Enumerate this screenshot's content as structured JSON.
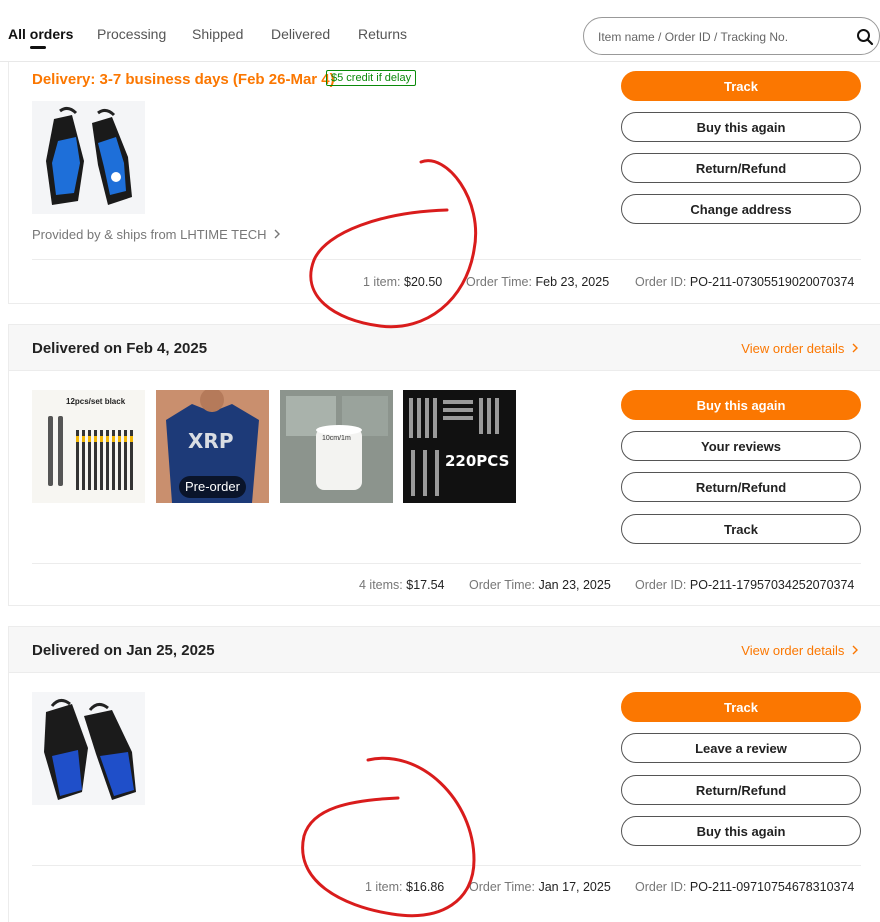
{
  "tabs": {
    "items": [
      {
        "label": "All orders"
      },
      {
        "label": "Processing"
      },
      {
        "label": "Shipped"
      },
      {
        "label": "Delivered"
      },
      {
        "label": "Returns"
      }
    ],
    "active": "All orders"
  },
  "search": {
    "placeholder": "Item name / Order ID / Tracking No.",
    "icon": "search-icon"
  },
  "orders": [
    {
      "delivery": "Delivery: 3-7 business days (Feb 26-Mar 4)",
      "credit_badge": "$5 credit if delay",
      "provided_by": "Provided by & ships from LHTIME TECH",
      "items_label": "1 item:",
      "items_total": "$20.50",
      "order_time_label": "Order Time:",
      "order_time": "Feb 23, 2025",
      "order_id_label": "Order ID:",
      "order_id": "PO-211-07305519020070374",
      "buttons": [
        "Track",
        "Buy this again",
        "Return/Refund",
        "Change address"
      ]
    },
    {
      "status": "Delivered on Feb 4, 2025",
      "view_details": "View order details",
      "items_label": "4 items:",
      "items_total": "$17.54",
      "order_time_label": "Order Time:",
      "order_time": "Jan 23, 2025",
      "order_id_label": "Order ID:",
      "order_id": "PO-211-17957034252070374",
      "buttons": [
        "Buy this again",
        "Your reviews",
        "Return/Refund",
        "Track"
      ],
      "thumb_texts": {
        "pens": "12pcs/set black",
        "shirt": "XRP",
        "preorder": "Pre-order",
        "tape": "10cm/1m",
        "pins": "220PCS"
      }
    },
    {
      "status": "Delivered on Jan 25, 2025",
      "view_details": "View order details",
      "items_label": "1 item:",
      "items_total": "$16.86",
      "order_time_label": "Order Time:",
      "order_time": "Jan 17, 2025",
      "order_id_label": "Order ID:",
      "order_id": "PO-211-09710754678310374",
      "buttons": [
        "Track",
        "Leave a review",
        "Return/Refund",
        "Buy this again"
      ]
    }
  ],
  "colors": {
    "accent": "#fb7701",
    "credit_green": "#0a8a0a",
    "annotation_red": "#d91c1c"
  }
}
